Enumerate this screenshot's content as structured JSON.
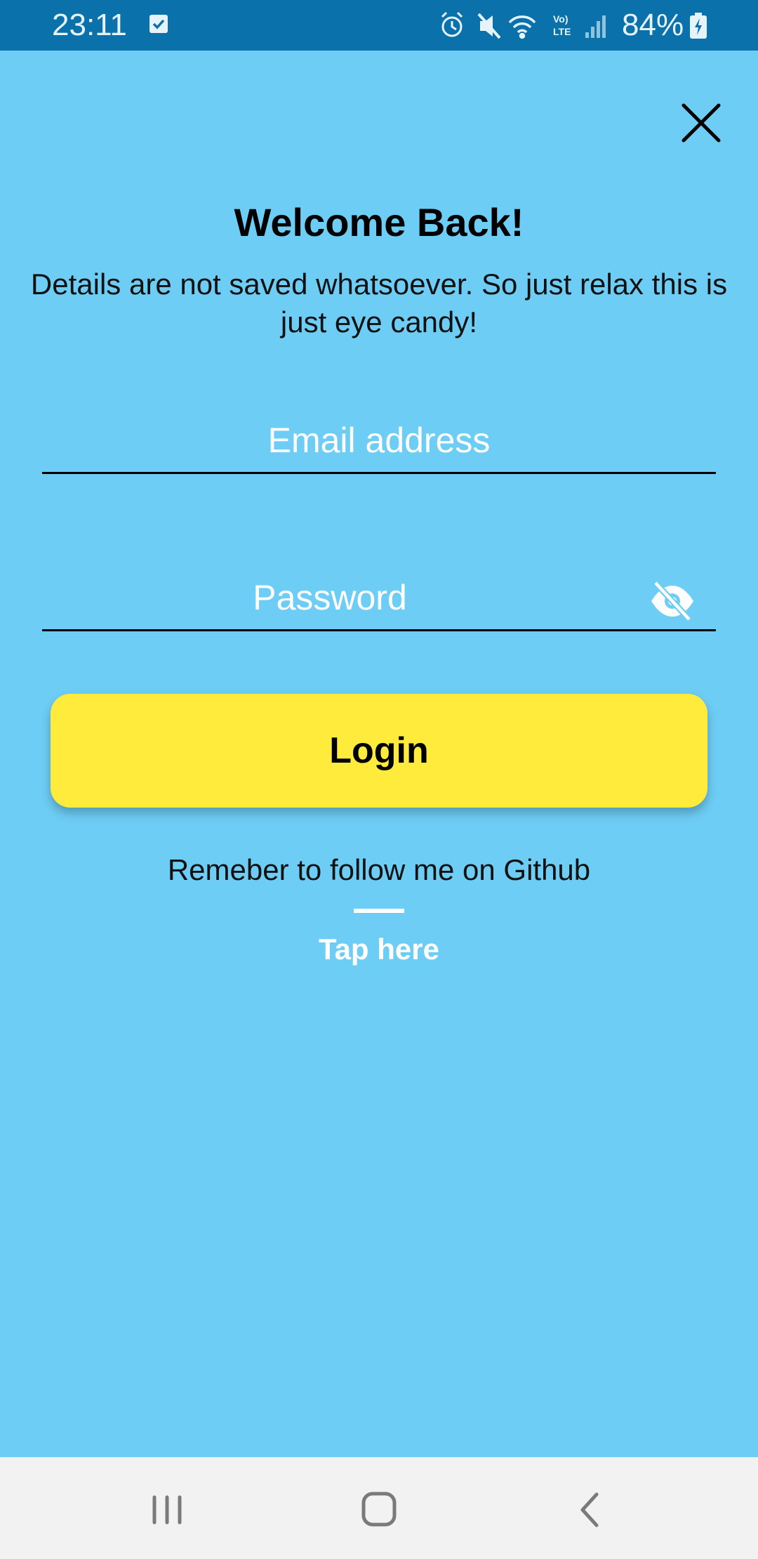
{
  "status_bar": {
    "time": "23:11",
    "battery": "84%",
    "network_label": "Vo) LTE"
  },
  "header": {
    "title": "Welcome Back!",
    "subtitle": "Details are not saved whatsoever. So just relax this is just eye candy!"
  },
  "form": {
    "email_placeholder": "Email address",
    "password_placeholder": "Password",
    "login_label": "Login"
  },
  "footer": {
    "github_text": "Remeber to follow me on Github",
    "tap_label": "Tap here"
  },
  "colors": {
    "background": "#6ECDF5",
    "status_bar": "#0A71AB",
    "button": "#FFEB3B",
    "nav_bar": "#F2F2F2"
  },
  "icons": [
    "check-icon",
    "alarm-icon",
    "mute-icon",
    "wifi-icon",
    "signal-icon",
    "battery-icon",
    "close-icon",
    "eye-off-icon",
    "recents-icon",
    "home-icon",
    "back-icon"
  ]
}
